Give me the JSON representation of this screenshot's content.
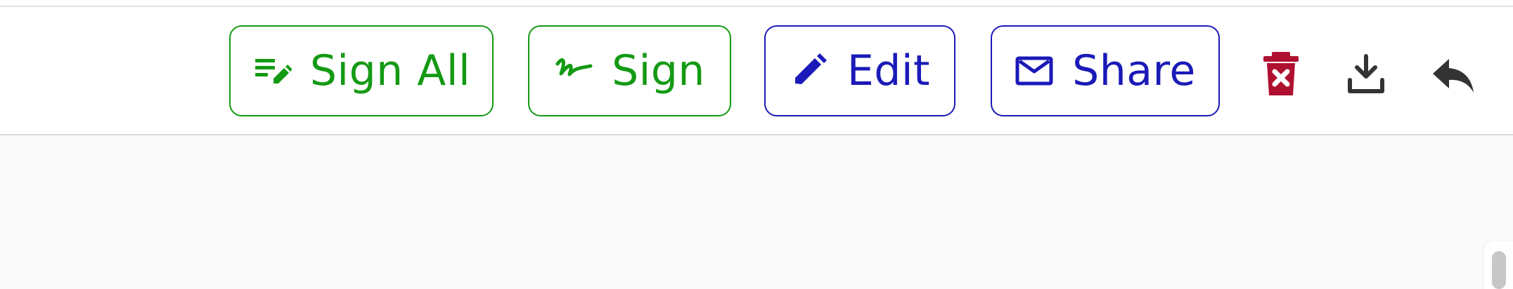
{
  "toolbar": {
    "buttons": [
      {
        "id": "sign_all",
        "label": "Sign All",
        "icon": "sign-all-icon"
      },
      {
        "id": "sign",
        "label": "Sign",
        "icon": "signature-icon"
      },
      {
        "id": "edit",
        "label": "Edit",
        "icon": "pencil-icon"
      },
      {
        "id": "share",
        "label": "Share",
        "icon": "mail-icon"
      }
    ],
    "actions": [
      {
        "id": "delete",
        "icon": "trash-icon"
      },
      {
        "id": "download",
        "icon": "download-icon"
      },
      {
        "id": "reply",
        "icon": "reply-icon"
      }
    ]
  },
  "colors": {
    "green_accent": "#149a14",
    "blue_accent": "#1a1ab8",
    "delete_red": "#b0102f",
    "icon_dark": "#333333",
    "content_background": "#f9f9f9",
    "divider": "#dcdcdc",
    "scrollbar_thumb": "#c7c7c7"
  }
}
